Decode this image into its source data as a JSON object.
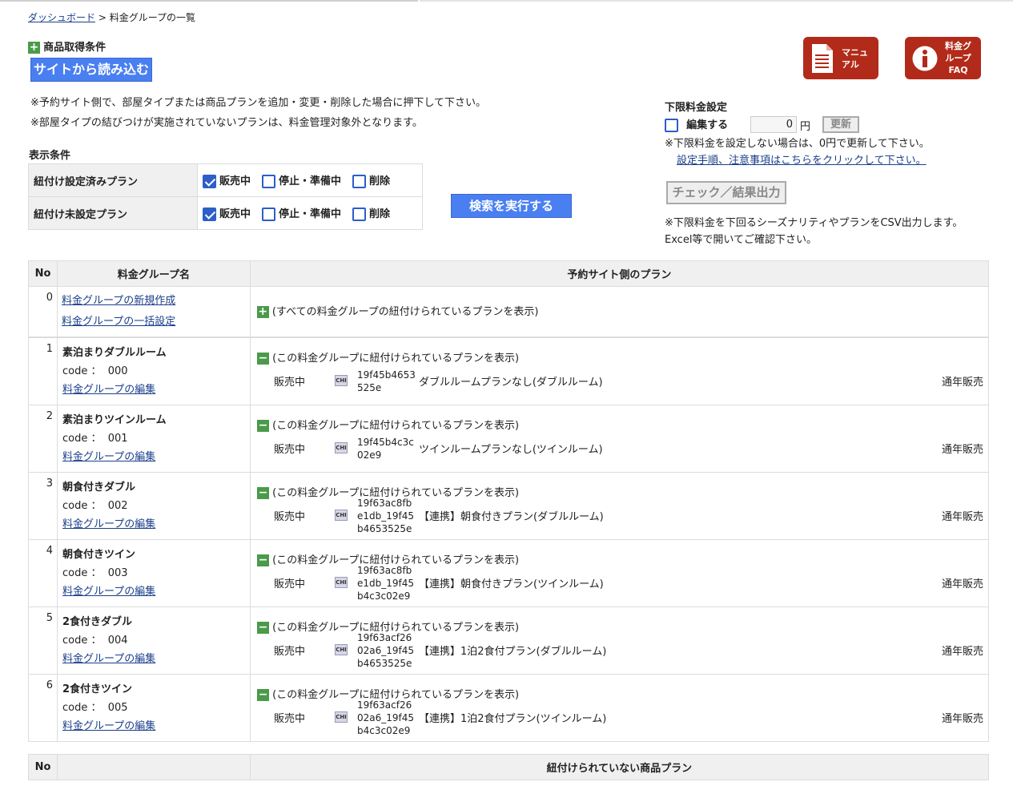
{
  "breadcrumb": {
    "home": "ダッシュボード",
    "sep": ">",
    "current": "料金グループの一覧"
  },
  "acquire": {
    "title": "商品取得条件",
    "load_button": "サイトから読み込む"
  },
  "notes": [
    "※予約サイト側で、部屋タイプまたは商品プランを追加・変更・削除した場合に押下して下さい。",
    "※部屋タイプの結びつけが実施されていないプランは、料金管理対象外となります。"
  ],
  "buttons": {
    "manual": "マニュアル",
    "manual_l1": "マニュ",
    "manual_l2": "アル",
    "faq_l1": "料金グ",
    "faq_l2": "ループ",
    "faq_l3": "FAQ"
  },
  "min_price": {
    "title": "下限料金設定",
    "edit_label": "編集する",
    "value": "0",
    "unit": "円",
    "update": "更新",
    "note": "※下限料金を設定しない場合は、0円で更新して下さい。",
    "link": "設定手順、注意事項はこちらをクリックして下さい。",
    "check_button": "チェック／結果出力",
    "csv_note1": "※下限料金を下回るシーズナリティやプランをCSV出力します。",
    "csv_note2": "Excel等で開いてご確認下さい。"
  },
  "display": {
    "title": "表示条件",
    "rows": [
      {
        "label": "紐付け設定済みプラン",
        "opts": [
          {
            "label": "販売中",
            "checked": true
          },
          {
            "label": "停止・準備中",
            "checked": false
          },
          {
            "label": "削除",
            "checked": false
          }
        ]
      },
      {
        "label": "紐付け未設定プラン",
        "opts": [
          {
            "label": "販売中",
            "checked": true
          },
          {
            "label": "停止・準備中",
            "checked": false
          },
          {
            "label": "削除",
            "checked": false
          }
        ]
      }
    ],
    "search_button": "検索を実行する"
  },
  "table": {
    "headers": {
      "no": "No",
      "group": "料金グループ名",
      "plans": "予約サイト側のプラン"
    },
    "row0": {
      "no": "0",
      "link1": "料金グループの新規作成",
      "link2": "料金グループの一括設定",
      "toggle": "(すべての料金グループの紐付けられているプランを表示)"
    },
    "rows": [
      {
        "no": "1",
        "name": "素泊まりダブルルーム",
        "code_label": "code ：",
        "code": "000",
        "edit": "料金グループの編集",
        "toggle": "(この料金グループに紐付けられているプランを表示)",
        "status": "販売中",
        "tag": "CHI",
        "plan_id_lines": [
          "19f45b4653",
          "525e"
        ],
        "plan_name": "ダブルルームプランなし(ダブルルーム)",
        "sale": "通年販売"
      },
      {
        "no": "2",
        "name": "素泊まりツインルーム",
        "code_label": "code ：",
        "code": "001",
        "edit": "料金グループの編集",
        "toggle": "(この料金グループに紐付けられているプランを表示)",
        "status": "販売中",
        "tag": "CHI",
        "plan_id_lines": [
          "19f45b4c3c",
          "02e9"
        ],
        "plan_name": "ツインルームプランなし(ツインルーム)",
        "sale": "通年販売"
      },
      {
        "no": "3",
        "name": "朝食付きダブル",
        "code_label": "code ：",
        "code": "002",
        "edit": "料金グループの編集",
        "toggle": "(この料金グループに紐付けられているプランを表示)",
        "status": "販売中",
        "tag": "CHI",
        "plan_id_lines": [
          "19f63ac8fb",
          "e1db_19f45",
          "b4653525e"
        ],
        "plan_name": "【連携】朝食付きプラン(ダブルルーム)",
        "sale": "通年販売"
      },
      {
        "no": "4",
        "name": "朝食付きツイン",
        "code_label": "code ：",
        "code": "003",
        "edit": "料金グループの編集",
        "toggle": "(この料金グループに紐付けられているプランを表示)",
        "status": "販売中",
        "tag": "CHI",
        "plan_id_lines": [
          "19f63ac8fb",
          "e1db_19f45",
          "b4c3c02e9"
        ],
        "plan_name": "【連携】朝食付きプラン(ツインルーム)",
        "sale": "通年販売"
      },
      {
        "no": "5",
        "name": "2食付きダブル",
        "code_label": "code ：",
        "code": "004",
        "edit": "料金グループの編集",
        "toggle": "(この料金グループに紐付けられているプランを表示)",
        "status": "販売中",
        "tag": "CHI",
        "plan_id_lines": [
          "19f63acf26",
          "02a6_19f45",
          "b4653525e"
        ],
        "plan_name": "【連携】1泊2食付プラン(ダブルルーム)",
        "sale": "通年販売"
      },
      {
        "no": "6",
        "name": "2食付きツイン",
        "code_label": "code ：",
        "code": "005",
        "edit": "料金グループの編集",
        "toggle": "(この料金グループに紐付けられているプランを表示)",
        "status": "販売中",
        "tag": "CHI",
        "plan_id_lines": [
          "19f63acf26",
          "02a6_19f45",
          "b4c3c02e9"
        ],
        "plan_name": "【連携】1泊2食付プラン(ツインルーム)",
        "sale": "通年販売"
      }
    ]
  },
  "unlinked": {
    "no": "No",
    "title": "紐付けられていない商品プラン"
  }
}
